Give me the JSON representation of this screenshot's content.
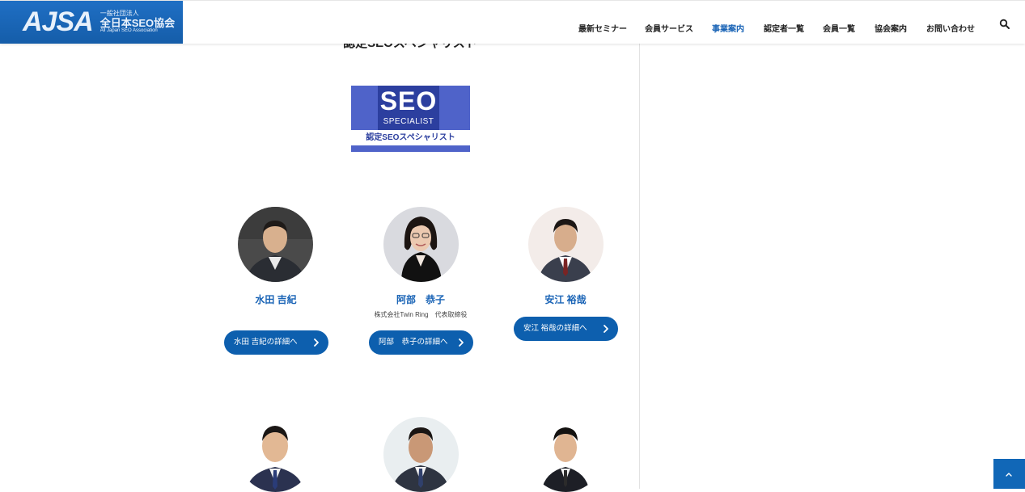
{
  "header": {
    "logo": {
      "mark": "AJSA",
      "org_type": "一般社団法人",
      "name": "全日本SEO協会",
      "name_en": "All Japan SEO Association"
    },
    "nav": [
      {
        "label": "最新セミナー",
        "active": false
      },
      {
        "label": "会員サービス",
        "active": false
      },
      {
        "label": "事業案内",
        "active": true
      },
      {
        "label": "認定者一覧",
        "active": false
      },
      {
        "label": "会員一覧",
        "active": false
      },
      {
        "label": "協会案内",
        "active": false
      },
      {
        "label": "お問い合わせ",
        "active": false
      }
    ],
    "search_icon": "search-icon"
  },
  "section": {
    "title": "認定SEOスペシャリスト"
  },
  "badge": {
    "line1": "SEO",
    "line2": "SPECIALIST",
    "line3": "認定SEOスペシャリスト"
  },
  "people": [
    {
      "name": "水田 吉紀",
      "company": "",
      "button": "水田 吉紀の詳細へ"
    },
    {
      "name": "阿部　恭子",
      "company": "株式会社Twin Ring　代表取締役",
      "button": "阿部　恭子の詳細へ"
    },
    {
      "name": "安江 裕哉",
      "company": "",
      "button": "安江 裕哉の詳細へ"
    }
  ],
  "colors": {
    "brand": "#1a64b6",
    "button": "#0d5fae",
    "badge": "#4f63c9",
    "badge_dark": "#2c3f9f"
  },
  "scroll_top_icon": "chevron-up-icon"
}
